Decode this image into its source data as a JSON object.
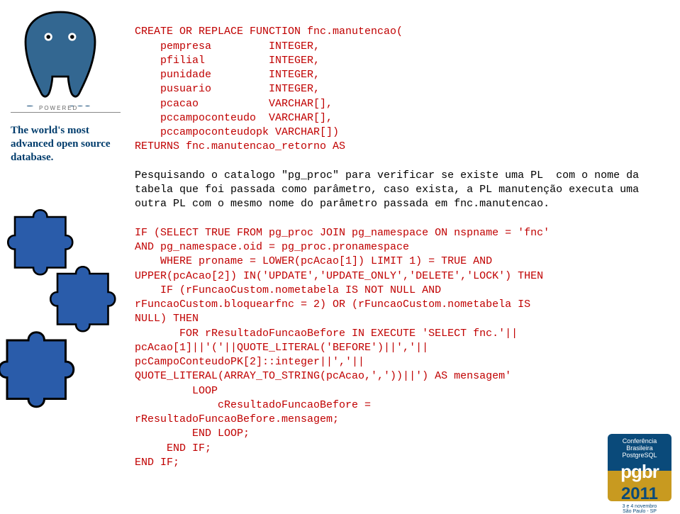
{
  "sidebar": {
    "product": "PostgreSQL",
    "powered": "POWERED",
    "tagline": "The world's most advanced open source database."
  },
  "code": {
    "line1": "CREATE OR REPLACE FUNCTION fnc.manutencao(",
    "line2": "    pempresa         INTEGER,",
    "line3": "    pfilial          INTEGER,",
    "line4": "    punidade         INTEGER,",
    "line5": "    pusuario         INTEGER,",
    "line6": "    pcacao           VARCHAR[],",
    "line7": "    pccampoconteudo  VARCHAR[],",
    "line8": "    pccampoconteudopk VARCHAR[])",
    "line9": "RETURNS fnc.manutencao_retorno AS",
    "body1": "Pesquisando o catalogo \"pg_proc\" para verificar se existe uma PL  com o nome da tabela que foi passada como parâmetro, caso exista, a PL manutenção executa uma outra PL com o mesmo nome do parâmetro passada em fnc.manutencao.",
    "line10": "IF (SELECT TRUE FROM pg_proc JOIN pg_namespace ON nspname = 'fnc'",
    "line11": "AND pg_namespace.oid = pg_proc.pronamespace",
    "line12": "    WHERE proname = LOWER(pcAcao[1]) LIMIT 1) = TRUE AND",
    "line13": "UPPER(pcAcao[2]) IN('UPDATE','UPDATE_ONLY','DELETE','LOCK') THEN",
    "line14": "    IF (rFuncaoCustom.nometabela IS NOT NULL AND",
    "line15": "rFuncaoCustom.bloquearfnc = 2) OR (rFuncaoCustom.nometabela IS",
    "line16": "NULL) THEN",
    "line17": "       FOR rResultadoFuncaoBefore IN EXECUTE 'SELECT fnc.'||",
    "line18": "pcAcao[1]||'('||QUOTE_LITERAL('BEFORE')||','||",
    "line19": "pcCampoConteudoPK[2]::integer||','||",
    "line20": "QUOTE_LITERAL(ARRAY_TO_STRING(pcAcao,','))||') AS mensagem'",
    "line21": "         LOOP",
    "line22": "             cResultadoFuncaoBefore =",
    "line23": "rResultadoFuncaoBefore.mensagem;",
    "line24": "         END LOOP;",
    "line25": "     END IF;",
    "line26": "END IF;"
  },
  "badge": {
    "top1": "Conferência",
    "top2": "Brasileira",
    "top3": "PostgreSQL",
    "mid": "pgbr",
    "year": "2011",
    "date": "3 e 4 novembro",
    "loc": "São Paulo - SP"
  }
}
